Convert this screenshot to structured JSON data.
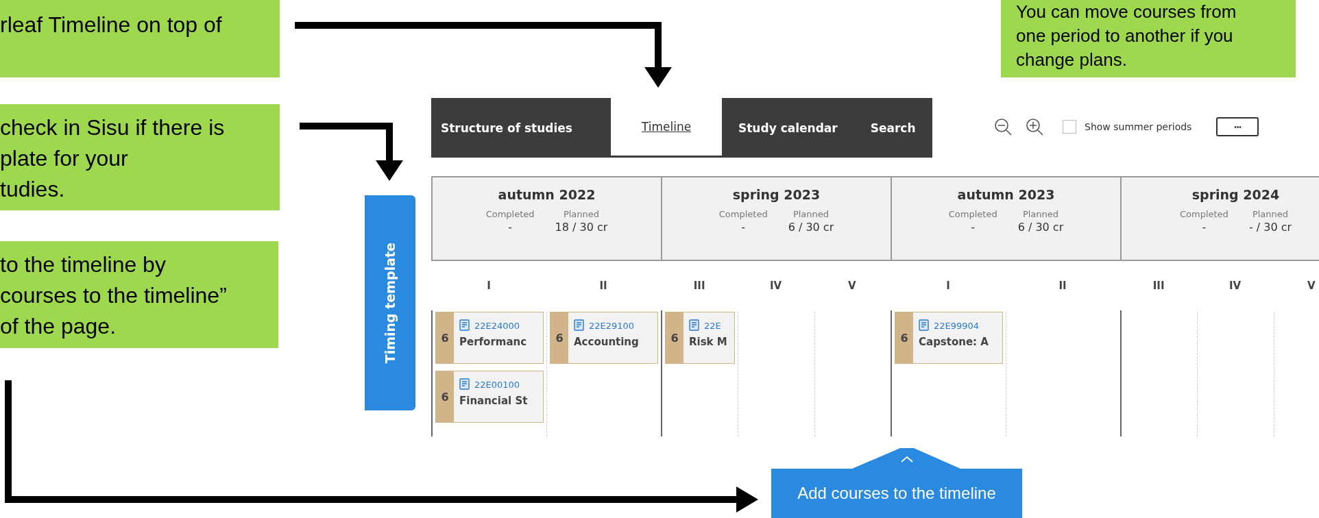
{
  "callouts": [
    {
      "lines": [
        "rleaf Timeline on top of"
      ]
    },
    {
      "lines": [
        "check in Sisu if there is",
        "plate for your",
        "tudies."
      ]
    },
    {
      "lines": [
        "to the timeline by",
        "courses to the timeline”",
        "of the page."
      ]
    },
    {
      "lines": [
        "You can move courses from",
        "one period to another if you",
        "change plans."
      ]
    }
  ],
  "tabs": [
    {
      "label": "Structure of studies",
      "selected": false
    },
    {
      "label": "Timeline",
      "selected": true
    },
    {
      "label": "Study calendar",
      "selected": false
    },
    {
      "label": "Search",
      "selected": false
    }
  ],
  "summer_checkbox": {
    "label": "Show summer periods",
    "checked": false
  },
  "more_button": {
    "label": "•••"
  },
  "timing_template": {
    "label": "Timing template"
  },
  "terms": [
    {
      "title": "autumn 2022",
      "completed_label": "Completed",
      "completed": "-",
      "planned_label": "Planned",
      "planned": "18 / 30 cr",
      "periods": [
        {
          "label": "I",
          "courses": [
            {
              "credits": "6",
              "code": "22E24000",
              "name": "Performanc"
            },
            {
              "credits": "6",
              "code": "22E00100",
              "name": "Financial St"
            }
          ]
        },
        {
          "label": "II",
          "courses": [
            {
              "credits": "6",
              "code": "22E29100",
              "name": "Accounting"
            }
          ]
        }
      ]
    },
    {
      "title": "spring 2023",
      "completed_label": "Completed",
      "completed": "-",
      "planned_label": "Planned",
      "planned": "6 / 30 cr",
      "periods": [
        {
          "label": "III",
          "courses": [
            {
              "credits": "6",
              "code": "22E",
              "name": "Risk M"
            }
          ]
        },
        {
          "label": "IV"
        },
        {
          "label": "V"
        }
      ]
    },
    {
      "title": "autumn 2023",
      "completed_label": "Completed",
      "completed": "-",
      "planned_label": "Planned",
      "planned": "6 / 30 cr",
      "periods": [
        {
          "label": "I",
          "courses": [
            {
              "credits": "6",
              "code": "22E99904",
              "name": "Capstone: A"
            }
          ]
        },
        {
          "label": "II"
        }
      ]
    },
    {
      "title": "spring 2024",
      "completed_label": "Completed",
      "completed": "-",
      "planned_label": "Planned",
      "planned": "- / 30 cr",
      "periods": [
        {
          "label": "III"
        },
        {
          "label": "IV"
        },
        {
          "label": "V"
        }
      ]
    }
  ],
  "add_button": {
    "label": "Add courses to the timeline"
  }
}
